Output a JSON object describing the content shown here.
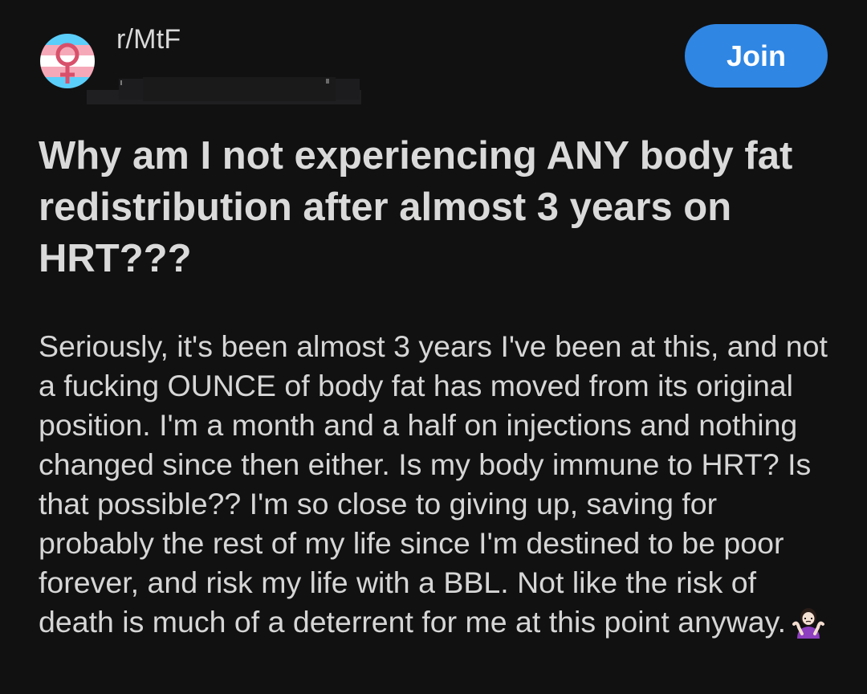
{
  "post": {
    "subreddit": "r/MtF",
    "join_label": "Join",
    "title": "Why am I not experiencing ANY body fat redistribution after almost 3 years on HRT???",
    "body": "Seriously, it's been almost 3 years I've been at this, and not a fucking OUNCE of body fat has moved from its original position. I'm a month and a half on injections and nothing changed since then either. Is my body immune to HRT? Is that possible?? I'm so close to giving up, saving for probably the rest of my life since I'm destined to be poor forever, and risk my life with a BBL. Not like the risk of death is much of a deterrent for me at this point anyway.",
    "body_emoji": "person-shrugging-emoji"
  },
  "icons": {
    "subreddit_avatar": "trans-flag-female-symbol-icon"
  },
  "colors": {
    "background": "#111112",
    "join_button": "#2f86e3",
    "flag_blue": "#5bcefa",
    "flag_pink": "#f5a9b8",
    "flag_white": "#ffffff",
    "symbol": "#d8506b"
  }
}
